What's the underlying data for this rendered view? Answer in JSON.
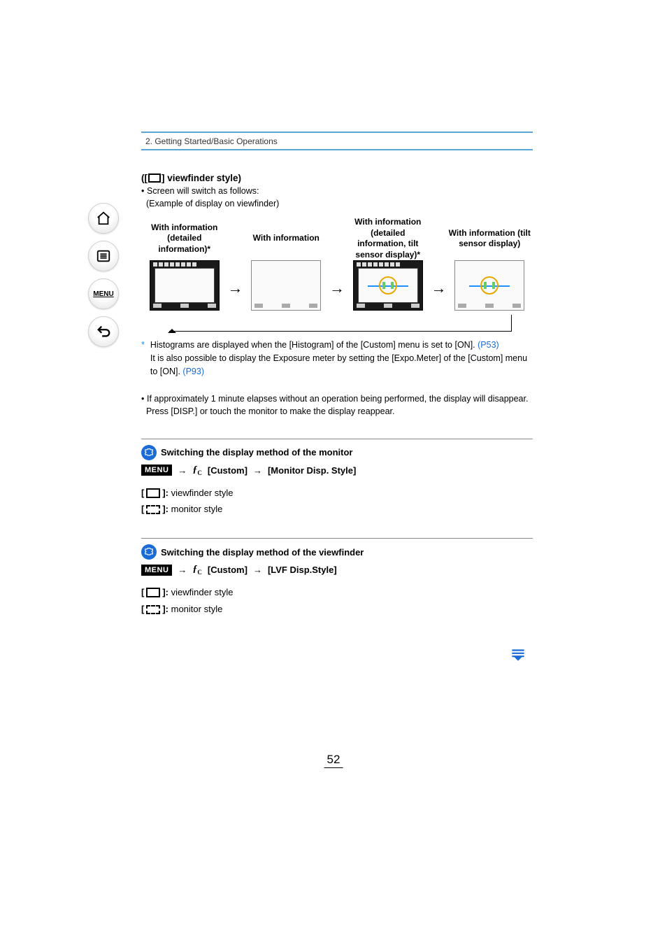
{
  "chapter": "2. Getting Started/Basic Operations",
  "heading": {
    "prefix": "([",
    "suffix": "] viewfinder style)"
  },
  "intro": {
    "line1": "Screen will switch as follows:",
    "line2": "(Example of display on viewfinder)"
  },
  "diagram": {
    "labels": [
      "With information (detailed information)*",
      "With information",
      "With information (detailed information, tilt sensor display)*",
      "With information (tilt sensor display)"
    ]
  },
  "footnote": {
    "star": "*",
    "text1": "Histograms are displayed when the [Histogram] of the [Custom] menu is set to [ON]. ",
    "link1": "(P53)",
    "text2": "It is also possible to display the Exposure meter by setting the [Expo.Meter] of the [Custom] menu to [ON]. ",
    "link2": "(P93)"
  },
  "note": {
    "line1": "If approximately 1 minute elapses without an operation being performed, the display will disappear.",
    "line2": "Press [DISP.] or touch the monitor to make the display reappear."
  },
  "tip1": {
    "title": "Switching the display method of the monitor",
    "menu_label": "MENU",
    "path_custom": "[Custom]",
    "path_item": "[Monitor Disp. Style]",
    "opt1_suffix": " viewfinder style",
    "opt2_suffix": " monitor style"
  },
  "tip2": {
    "title": "Switching the display method of the viewfinder",
    "menu_label": "MENU",
    "path_custom": "[Custom]",
    "path_item": "[LVF Disp.Style]",
    "opt1_suffix": " viewfinder style",
    "opt2_suffix": " monitor style"
  },
  "page_number": "52"
}
